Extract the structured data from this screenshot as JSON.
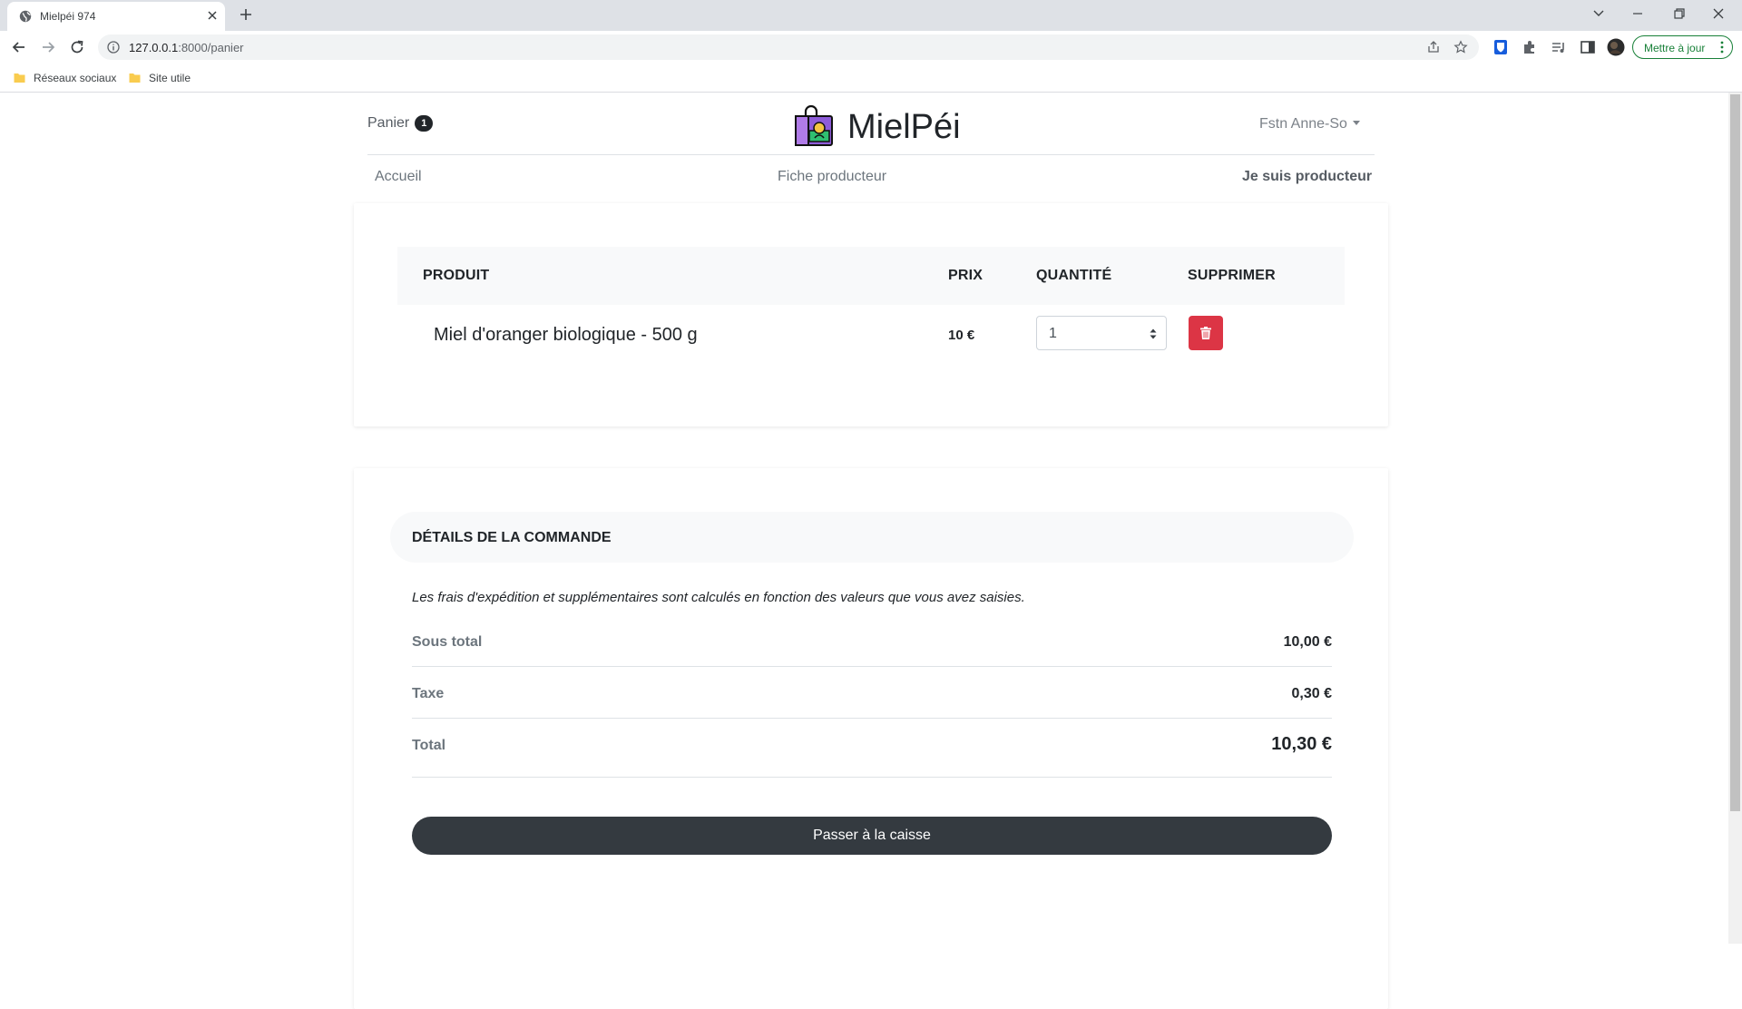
{
  "browser": {
    "tab_title": "Mielpéi 974",
    "url_host": "127.0.0.1",
    "url_rest": ":8000/panier",
    "update_button": "Mettre à jour",
    "bookmarks": [
      "Réseaux sociaux",
      "Site utile"
    ]
  },
  "header": {
    "cart_label": "Panier",
    "cart_count": "1",
    "brand": "MielPéi",
    "user": "Fstn Anne-So"
  },
  "nav": {
    "home": "Accueil",
    "producer_sheet": "Fiche producteur",
    "i_am_producer": "Je suis producteur"
  },
  "cart": {
    "columns": [
      "Produit",
      "Prix",
      "Quantité",
      "Supprimer"
    ],
    "items": [
      {
        "name": "Miel d'oranger biologique - 500 g",
        "price": "10 €",
        "quantity": "1"
      }
    ]
  },
  "order": {
    "title": "Détails de la commande",
    "note": "Les frais d'expédition et supplémentaires sont calculés en fonction des valeurs que vous avez saisies.",
    "subtotal_label": "Sous total",
    "subtotal": "10,00 €",
    "tax_label": "Taxe",
    "tax": "0,30 €",
    "total_label": "Total",
    "total": "10,30 €",
    "checkout": "Passer à la caisse"
  },
  "colors": {
    "danger": "#dc3545",
    "dark": "#343a40",
    "update_green": "#188038"
  }
}
